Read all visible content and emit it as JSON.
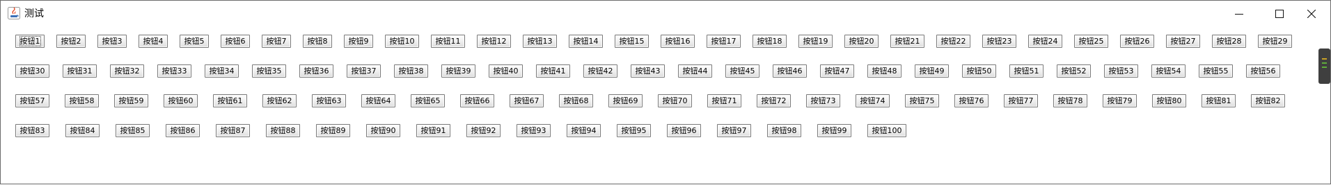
{
  "window": {
    "title": "测试",
    "icon": "java-icon",
    "controls": [
      "minimize-icon",
      "maximize-icon",
      "close-icon"
    ]
  },
  "buttons": [
    "按钮1",
    "按钮2",
    "按钮3",
    "按钮4",
    "按钮5",
    "按钮6",
    "按钮7",
    "按钮8",
    "按钮9",
    "按钮10",
    "按钮11",
    "按钮12",
    "按钮13",
    "按钮14",
    "按钮15",
    "按钮16",
    "按钮17",
    "按钮18",
    "按钮19",
    "按钮20",
    "按钮21",
    "按钮22",
    "按钮23",
    "按钮24",
    "按钮25",
    "按钮26",
    "按钮27",
    "按钮28",
    "按钮29",
    "按钮30",
    "按钮31",
    "按钮32",
    "按钮33",
    "按钮34",
    "按钮35",
    "按钮36",
    "按钮37",
    "按钮38",
    "按钮39",
    "按钮40",
    "按钮41",
    "按钮42",
    "按钮43",
    "按钮44",
    "按钮45",
    "按钮46",
    "按钮47",
    "按钮48",
    "按钮49",
    "按钮50",
    "按钮51",
    "按钮52",
    "按钮53",
    "按钮54",
    "按钮55",
    "按钮56",
    "按钮57",
    "按钮58",
    "按钮59",
    "按钮60",
    "按钮61",
    "按钮62",
    "按钮63",
    "按钮64",
    "按钮65",
    "按钮66",
    "按钮67",
    "按钮68",
    "按钮69",
    "按钮70",
    "按钮71",
    "按钮72",
    "按钮73",
    "按钮74",
    "按钮75",
    "按钮76",
    "按钮77",
    "按钮78",
    "按钮79",
    "按钮80",
    "按钮81",
    "按钮82",
    "按钮83",
    "按钮84",
    "按钮85",
    "按钮86",
    "按钮87",
    "按钮88",
    "按钮89",
    "按钮90",
    "按钮91",
    "按钮92",
    "按钮93",
    "按钮94",
    "按钮95",
    "按钮96",
    "按钮97",
    "按钮98",
    "按钮99",
    "按钮100"
  ],
  "focused_button": "按钮1"
}
